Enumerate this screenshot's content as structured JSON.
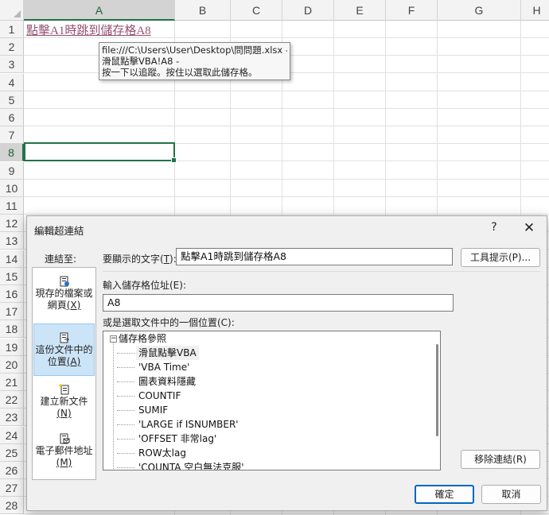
{
  "spreadsheet": {
    "columns": [
      "A",
      "B",
      "C",
      "D",
      "E",
      "F",
      "G",
      "H"
    ],
    "selected_column": "A",
    "rows": [
      "1",
      "2",
      "3",
      "4",
      "5",
      "6",
      "7",
      "8",
      "9",
      "10",
      "11",
      "12",
      "13",
      "14",
      "15",
      "16",
      "17",
      "18",
      "19",
      "20",
      "21",
      "22",
      "23",
      "24",
      "25",
      "26",
      "27",
      "28"
    ],
    "selected_row": "8",
    "cell_a1_text": "點擊A1時跳到儲存格A8",
    "hyperlink_color": "#954f72",
    "selection_color": "#217346",
    "tooltip": {
      "line1": "file:///C:\\Users\\User\\Desktop\\問問題.xlsx -",
      "line2": "滑鼠點擊VBA!A8 -",
      "line3": "按一下以追蹤。按住以選取此儲存格。"
    }
  },
  "dialog": {
    "title": "編輯超連結",
    "help_label": "?",
    "close_label": "✕",
    "link_to_label": "連結至:",
    "link_options": [
      {
        "icon": "existing-file-icon",
        "line1": "現存的檔案或",
        "line2": "網頁",
        "key": "(X)",
        "selected": false
      },
      {
        "icon": "place-in-document-icon",
        "line1": "這份文件中的",
        "line2": "位置",
        "key": "(A)",
        "selected": true
      },
      {
        "icon": "new-document-icon",
        "line1": "建立新文件",
        "line2": "",
        "key": "(N)",
        "selected": false
      },
      {
        "icon": "email-address-icon",
        "line1": "電子郵件地址",
        "line2": "",
        "key": "(M)",
        "selected": false
      }
    ],
    "display_text_label": "要顯示的文字(",
    "display_text_key": "T",
    "display_text_label_end": "):",
    "display_text_value": "點擊A1時跳到儲存格A8",
    "screentip_button": "工具提示(P)...",
    "cell_ref_label": "輸入儲存格位址(E):",
    "cell_ref_value": "A8",
    "place_label": "或是選取文件中的一個位置(C):",
    "tree": {
      "root_toggle": "⊟",
      "root_label": "儲存格參照",
      "items": [
        "滑鼠點擊VBA",
        "'VBA Time'",
        "圖表資料隱藏",
        "COUNTIF",
        "SUMIF",
        "'LARGE  if  ISNUMBER'",
        "'OFFSET  非常lag'",
        "ROW太lag",
        "'COUNTA 空白無法克服'"
      ],
      "selected_index": 0
    },
    "remove_link_button": "移除連結(R)",
    "ok_button": "確定",
    "cancel_button": "取消"
  }
}
